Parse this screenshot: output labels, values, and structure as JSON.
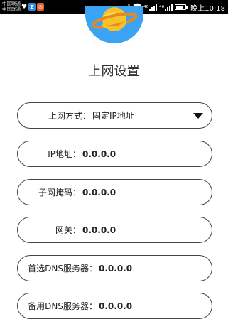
{
  "status_bar": {
    "carrier_1": "中国联通",
    "carrier_2": "中国联通",
    "time": "晚上10:18",
    "signal_1": "46",
    "signal_2": "46",
    "battery_level": 0.8
  },
  "page_title": "上网设置",
  "connection_type": {
    "label": "上网方式：",
    "value": "固定IP地址"
  },
  "fields": [
    {
      "label": "IP地址：",
      "value": "0.0.0.0"
    },
    {
      "label": "子网掩码：",
      "value": "0.0.0.0"
    },
    {
      "label": "网关：",
      "value": "0.0.0.0"
    },
    {
      "label": "首选DNS服务器：",
      "value": "0.0.0.0"
    },
    {
      "label": "备用DNS服务器：",
      "value": "0.0.0.0"
    }
  ],
  "colors": {
    "accent_blue": "#3aa3f3",
    "planet_yellow": "#f6c12b",
    "ring_orange": "#e88a1a"
  },
  "icons": [
    "planet-logo-icon",
    "dropdown-caret-icon",
    "wifi-icon",
    "bluetooth-icon",
    "battery-icon"
  ]
}
